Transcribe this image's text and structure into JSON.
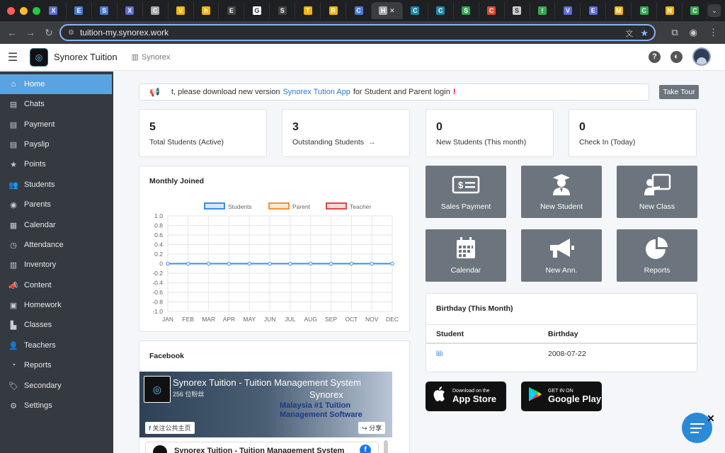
{
  "browser": {
    "tabs": [
      {
        "letter": "X",
        "color": "#5b6dd6"
      },
      {
        "letter": "E",
        "color": "#4a7ad8"
      },
      {
        "letter": "S",
        "color": "#4a7ad8"
      },
      {
        "letter": "X",
        "color": "#5b6dd6"
      },
      {
        "letter": "C",
        "color": "#aaaaaa"
      },
      {
        "letter": "V",
        "color": "#f4b400"
      },
      {
        "letter": "h",
        "color": "#f4b400"
      },
      {
        "letter": "E",
        "color": "#444444"
      },
      {
        "letter": "G",
        "color": "#ffffff"
      },
      {
        "letter": "S",
        "color": "#444444"
      },
      {
        "letter": "T",
        "color": "#f4b400"
      },
      {
        "letter": "R",
        "color": "#f4b400"
      },
      {
        "letter": "C",
        "color": "#4a7ad8"
      },
      {
        "letter": "H",
        "color": "#aaaaaa",
        "active": true
      },
      {
        "letter": "C",
        "color": "#1e88a8"
      },
      {
        "letter": "C",
        "color": "#1e88a8"
      },
      {
        "letter": "S",
        "color": "#34a853"
      },
      {
        "letter": "C",
        "color": "#e04a2a"
      },
      {
        "letter": "S",
        "color": "#cccccc"
      },
      {
        "letter": "!",
        "color": "#34a853"
      },
      {
        "letter": "V",
        "color": "#5b6dd6"
      },
      {
        "letter": "E",
        "color": "#5b6dd6"
      },
      {
        "letter": "M",
        "color": "#f4b400"
      },
      {
        "letter": "C",
        "color": "#34a853"
      },
      {
        "letter": "N",
        "color": "#f4b400"
      },
      {
        "letter": "C",
        "color": "#34a853"
      }
    ],
    "url": "tuition-my.synorex.work",
    "new_tab": "+"
  },
  "header": {
    "brand": "Synorex Tuition",
    "branch": "Synorex"
  },
  "sidebar": {
    "items": [
      {
        "label": "Home",
        "icon": "home-icon",
        "glyph": "⌂",
        "active": true
      },
      {
        "label": "Chats",
        "icon": "document-icon",
        "glyph": "▤"
      },
      {
        "label": "Payment",
        "icon": "document-icon",
        "glyph": "▤"
      },
      {
        "label": "Payslip",
        "icon": "document-icon",
        "glyph": "▤"
      },
      {
        "label": "Points",
        "icon": "star-icon",
        "glyph": "★"
      },
      {
        "label": "Students",
        "icon": "users-icon",
        "glyph": "👥"
      },
      {
        "label": "Parents",
        "icon": "user-circle-icon",
        "glyph": "◉"
      },
      {
        "label": "Calendar",
        "icon": "calendar-icon",
        "glyph": "▦"
      },
      {
        "label": "Attendance",
        "icon": "clock-icon",
        "glyph": "◷"
      },
      {
        "label": "Inventory",
        "icon": "inventory-icon",
        "glyph": "▥"
      },
      {
        "label": "Content",
        "icon": "megaphone-icon",
        "glyph": "📣"
      },
      {
        "label": "Homework",
        "icon": "book-icon",
        "glyph": "▣"
      },
      {
        "label": "Classes",
        "icon": "school-icon",
        "glyph": "▙"
      },
      {
        "label": "Teachers",
        "icon": "teacher-icon",
        "glyph": "👤"
      },
      {
        "label": "Reports",
        "icon": "pie-chart-icon",
        "glyph": "◔"
      },
      {
        "label": "Secondary",
        "icon": "tags-icon",
        "glyph": "🏷"
      },
      {
        "label": "Settings",
        "icon": "cogs-icon",
        "glyph": "⚙"
      }
    ]
  },
  "announcement": {
    "text_before": "t, please download new version",
    "link": "Synorex Tution App",
    "text_after": "for Student and Parent login",
    "mark": "!",
    "tour_button": "Take Tour"
  },
  "stats": [
    {
      "value": "5",
      "label": "Total Students (Active)"
    },
    {
      "value": "3",
      "label": "Outstanding Students",
      "arrow": "→"
    },
    {
      "value": "0",
      "label": "New Students (This month)"
    },
    {
      "value": "0",
      "label": "Check In (Today)"
    }
  ],
  "chart_card": {
    "title": "Monthly Joined"
  },
  "chart_data": {
    "type": "line",
    "categories": [
      "JAN",
      "FEB",
      "MAR",
      "APR",
      "MAY",
      "JUN",
      "JUL",
      "AUG",
      "SEP",
      "OCT",
      "NOV",
      "DEC"
    ],
    "series": [
      {
        "name": "Students",
        "color": "#3a8ee6",
        "values": [
          0,
          0,
          0,
          0,
          0,
          0,
          0,
          0,
          0,
          0,
          0,
          0
        ]
      },
      {
        "name": "Parent",
        "color": "#f0923a",
        "values": [
          0,
          0,
          0,
          0,
          0,
          0,
          0,
          0,
          0,
          0,
          0,
          0
        ]
      },
      {
        "name": "Teacher",
        "color": "#e04848",
        "values": [
          0,
          0,
          0,
          0,
          0,
          0,
          0,
          0,
          0,
          0,
          0,
          0
        ]
      }
    ],
    "yticks": [
      "1.0",
      "0.8",
      "0.6",
      "0.4",
      "0.2",
      "0",
      "-0.2",
      "-0.4",
      "-0.6",
      "-0.8",
      "-1.0"
    ],
    "ylim": [
      -1.0,
      1.0
    ],
    "grid": true,
    "legend": "top-center"
  },
  "tiles": [
    {
      "label": "Sales Payment",
      "icon": "cash-icon"
    },
    {
      "label": "New Student",
      "icon": "graduate-icon"
    },
    {
      "label": "New Class",
      "icon": "presentation-icon"
    },
    {
      "label": "Calendar",
      "icon": "calendar-icon"
    },
    {
      "label": "New Ann.",
      "icon": "megaphone-icon"
    },
    {
      "label": "Reports",
      "icon": "pie-chart-icon"
    }
  ],
  "birthday": {
    "title": "Birthday (This Month)",
    "col_student": "Student",
    "col_birthday": "Birthday",
    "rows": [
      {
        "student": "lili",
        "birthday": "2008-07-22"
      }
    ]
  },
  "stores": {
    "apple_small": "Download on the",
    "apple_big": "App Store",
    "google_small": "GET IN ON",
    "google_big": "Google Play"
  },
  "facebook": {
    "title": "Facebook",
    "page_name": "Synorex Tuition - Tuition Management System",
    "fans": "256 位粉丝",
    "cover_brand": "Synorex",
    "slogan_1": "Malaysia #1 Tuition",
    "slogan_2": "Management Software",
    "follow": "关注公共主页",
    "share": "分享",
    "post_title": "Synorex Tuition - Tuition Management System"
  }
}
